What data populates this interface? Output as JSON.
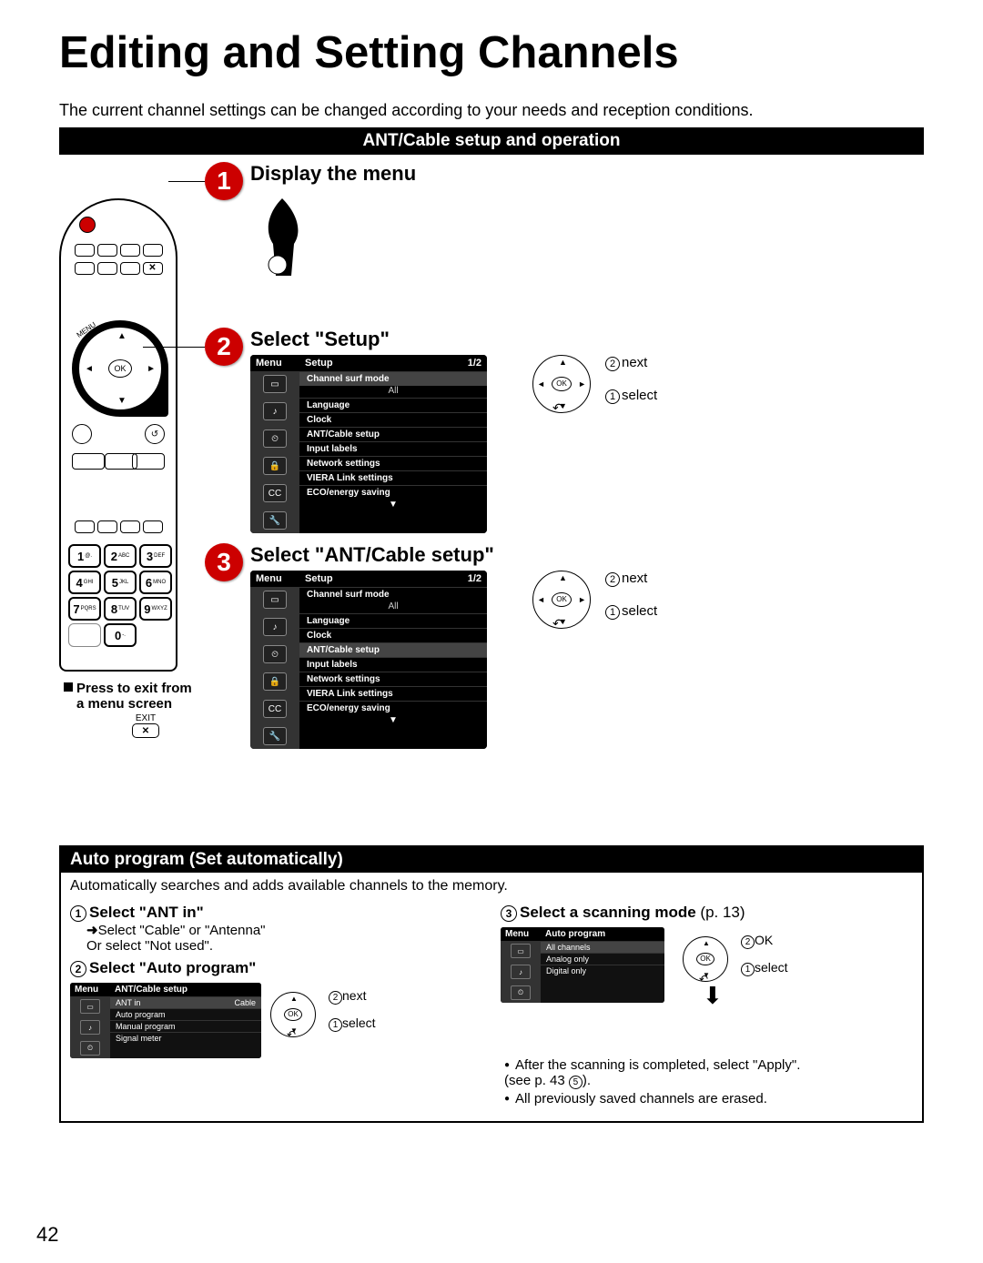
{
  "title": "Editing and Setting Channels",
  "intro": "The current channel settings can be changed according to your needs and reception conditions.",
  "section1_title": "ANT/Cable setup and operation",
  "steps": {
    "s1": {
      "num": "1",
      "title": "Display the menu"
    },
    "s2": {
      "num": "2",
      "title": "Select \"Setup\""
    },
    "s3": {
      "num": "3",
      "title": "Select \"ANT/Cable setup\""
    }
  },
  "osd": {
    "menu_label": "Menu",
    "setup_label": "Setup",
    "page": "1/2",
    "rows": [
      "Channel surf mode",
      "Language",
      "Clock",
      "ANT/Cable setup",
      "Input labels",
      "Network settings",
      "VIERA Link settings",
      "ECO/energy saving"
    ],
    "sub_all": "All"
  },
  "nav": {
    "ok": "OK",
    "next": "next",
    "select": "select",
    "n1": "1",
    "n2": "2"
  },
  "remote": {
    "ok": "OK",
    "menu": "MENU",
    "exit_x": "✕",
    "keys": [
      {
        "n": "1",
        "s": "@."
      },
      {
        "n": "2",
        "s": "ABC"
      },
      {
        "n": "3",
        "s": "DEF"
      },
      {
        "n": "4",
        "s": "GHI"
      },
      {
        "n": "5",
        "s": "JKL"
      },
      {
        "n": "6",
        "s": "MNO"
      },
      {
        "n": "7",
        "s": "PQRS"
      },
      {
        "n": "8",
        "s": "TUV"
      },
      {
        "n": "9",
        "s": "WXYZ"
      },
      {
        "n": "",
        "s": ""
      },
      {
        "n": "0",
        "s": "-."
      },
      {
        "n": "",
        "s": ""
      }
    ]
  },
  "exit_note": {
    "line1": "Press to exit from",
    "line2": "a menu screen",
    "exit_label": "EXIT",
    "x": "✕"
  },
  "ap": {
    "header": "Auto program (Set automatically)",
    "desc": "Automatically searches and adds available channels to the memory.",
    "s1_title": "Select \"ANT in\"",
    "s1_l1": "Select \"Cable\" or \"Antenna\"",
    "s1_l2": "Or select \"Not used\".",
    "s2_title": "Select \"Auto program\"",
    "s3_title": "Select a scanning mode",
    "s3_ref": " (p. 13)",
    "osd_ant": {
      "menu": "Menu",
      "title": "ANT/Cable setup",
      "rows": [
        {
          "label": "ANT in",
          "val": "Cable"
        },
        {
          "label": "Auto program",
          "val": ""
        },
        {
          "label": "Manual program",
          "val": ""
        },
        {
          "label": "Signal meter",
          "val": ""
        }
      ]
    },
    "osd_auto": {
      "menu": "Menu",
      "title": "Auto program",
      "rows": [
        "All channels",
        "Analog only",
        "Digital only"
      ]
    },
    "nav_ok": "OK",
    "bullet1a": "After the scanning is completed, select \"Apply\".",
    "bullet1b": "(see p. 43 ",
    "bullet1c": ").",
    "bullet1_num": "5",
    "bullet2": "All previously saved channels are erased."
  },
  "pagenum": "42"
}
